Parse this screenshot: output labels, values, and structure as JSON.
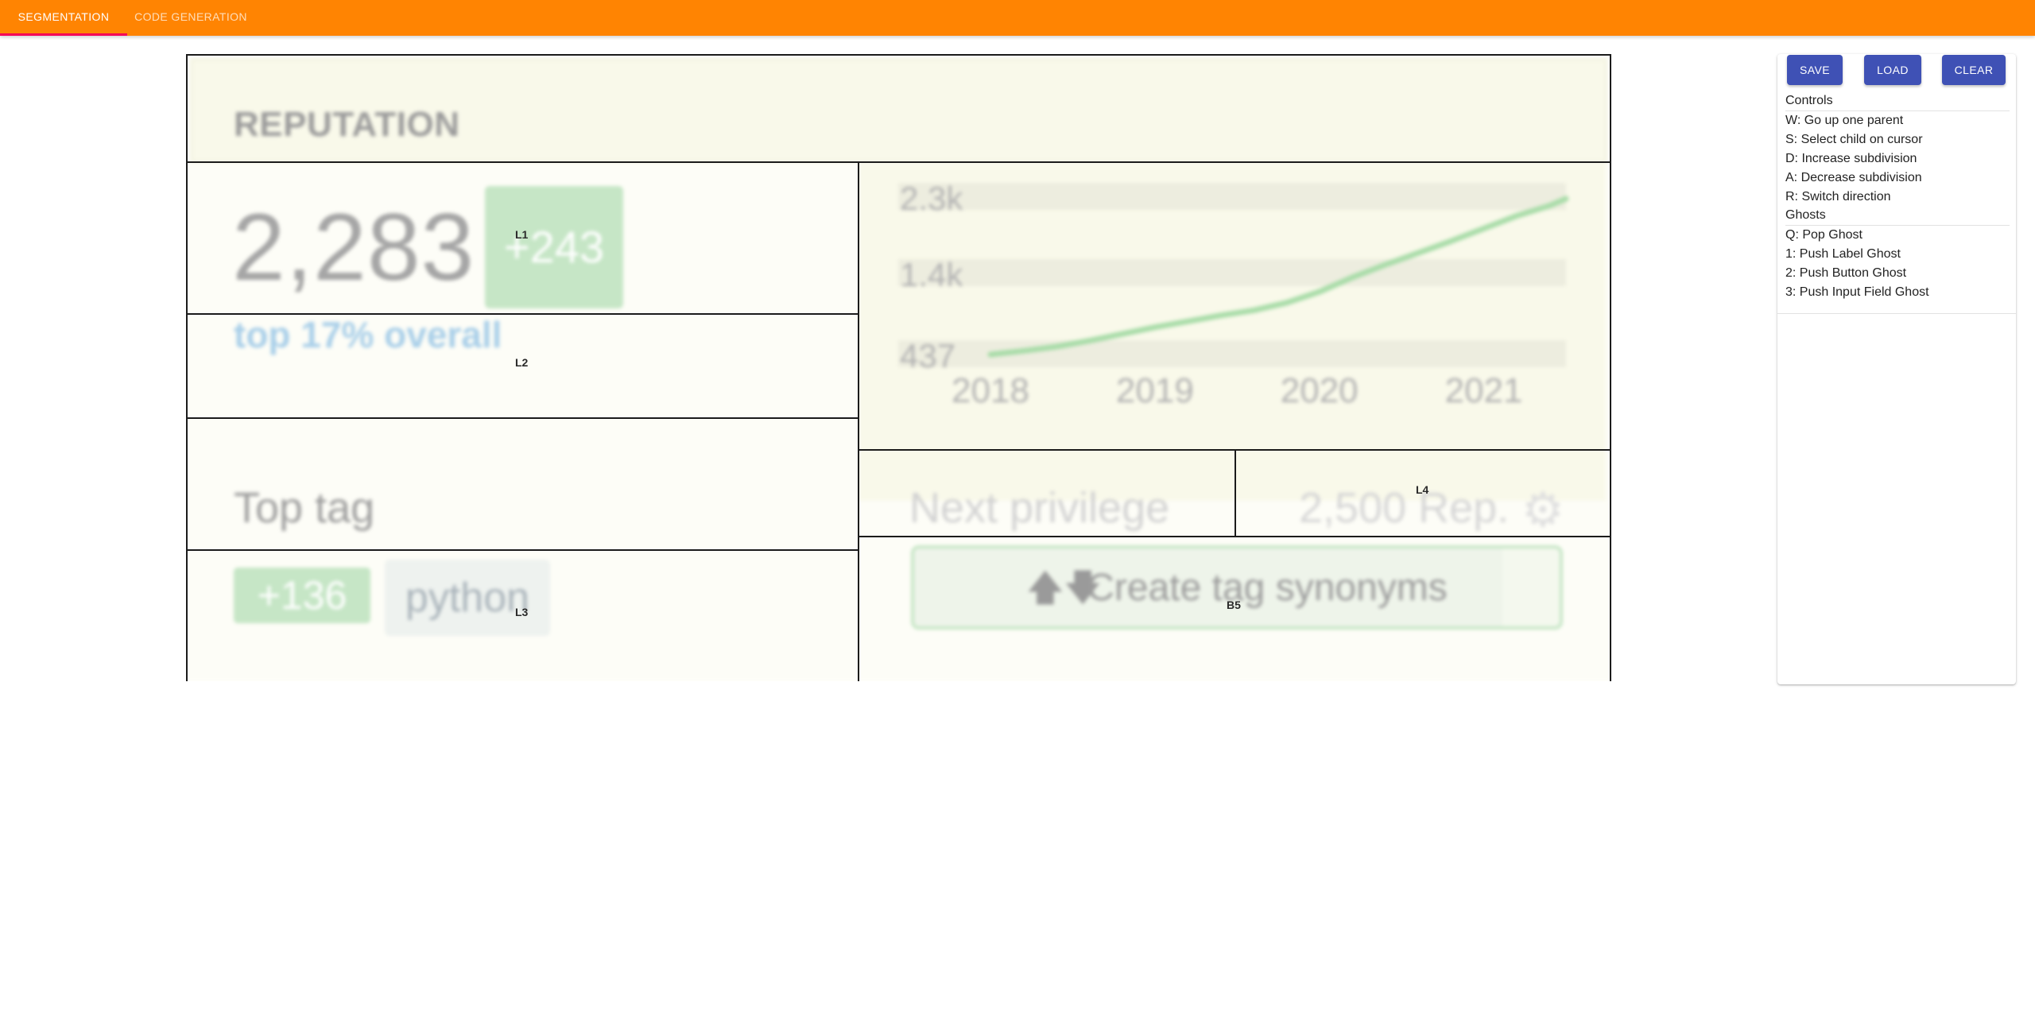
{
  "appbar": {
    "tabs": [
      {
        "label": "SEGMENTATION",
        "active": true
      },
      {
        "label": "CODE GENERATION",
        "active": false
      }
    ],
    "colors": {
      "bar": "#ff8402",
      "indicator": "#f50057"
    }
  },
  "canvas": {
    "screenshot": {
      "title": "REPUTATION",
      "reputation": "2,283",
      "delta": "+243",
      "rank": "top 17% overall",
      "top_tag_label": "Top tag",
      "top_tag_score": "+136",
      "top_tag_name": "python",
      "next_privilege_label": "Next privilege",
      "next_privilege_value": "2,500 Rep.",
      "gear_icon": "gear-icon",
      "action_button": "Create tag synonyms",
      "action_icon": "swap-vertical-arrows-icon"
    },
    "chart_data": {
      "type": "line",
      "x": [
        2018.0,
        2018.2,
        2018.4,
        2018.6,
        2018.8,
        2019.0,
        2019.2,
        2019.4,
        2019.6,
        2019.8,
        2020.0,
        2020.2,
        2020.4,
        2020.6,
        2020.8,
        2021.0,
        2021.2,
        2021.4,
        2021.5
      ],
      "series": [
        {
          "values": [
            437,
            480,
            530,
            600,
            680,
            760,
            830,
            900,
            960,
            1050,
            1180,
            1350,
            1500,
            1640,
            1780,
            1930,
            2080,
            2200,
            2283
          ]
        }
      ],
      "x_ticks": [
        "2018",
        "2019",
        "2020",
        "2021"
      ],
      "y_ticks": [
        "437",
        "1.4k",
        "2.3k"
      ],
      "y_tick_values": [
        437,
        1400,
        2300
      ],
      "xlim": [
        2018,
        2021.5
      ],
      "ylim": [
        437,
        2283
      ],
      "line_color": "#a8dca8",
      "band_color": "#ededdf"
    },
    "labels": [
      "L1",
      "L2",
      "L3",
      "L4",
      "B5"
    ]
  },
  "panel": {
    "buttons": {
      "save": "SAVE",
      "load": "LOAD",
      "clear": "CLEAR"
    },
    "controls_header": "Controls",
    "controls": [
      "W: Go up one parent",
      "S: Select child on cursor",
      "D: Increase subdivision",
      "A: Decrease subdivision",
      "R: Switch direction"
    ],
    "ghosts_header": "Ghosts",
    "ghosts": [
      "Q: Pop Ghost",
      "1: Push Label Ghost",
      "2: Push Button Ghost",
      "3: Push Input Field Ghost"
    ],
    "button_color": "#3f51b5"
  }
}
